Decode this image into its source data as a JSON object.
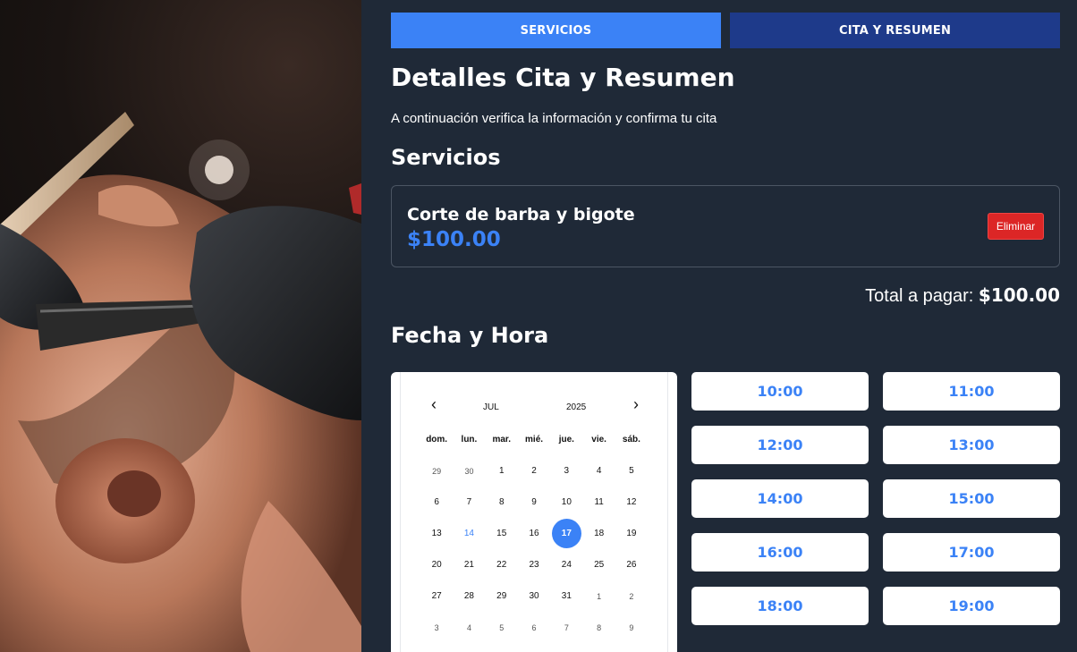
{
  "tabs": [
    {
      "label": "SERVICIOS"
    },
    {
      "label": "CITA Y RESUMEN"
    }
  ],
  "header": {
    "title": "Detalles Cita y Resumen",
    "subtitle": "A continuación verifica la información y confirma tu cita"
  },
  "services_section": {
    "heading": "Servicios",
    "items": [
      {
        "name": "Corte de barba y bigote",
        "price": "$100.00",
        "remove_label": "Eliminar"
      }
    ]
  },
  "total": {
    "label": "Total a pagar:",
    "value": "$100.00"
  },
  "datetime_section": {
    "heading": "Fecha y Hora"
  },
  "calendar": {
    "month": "JUL",
    "year": "2025",
    "prev_icon": "‹",
    "next_icon": "›",
    "weekdays": [
      "dom.",
      "lun.",
      "mar.",
      "mié.",
      "jue.",
      "vie.",
      "sáb."
    ],
    "days": [
      {
        "d": "29",
        "t": "other"
      },
      {
        "d": "30",
        "t": "other"
      },
      {
        "d": "1"
      },
      {
        "d": "2"
      },
      {
        "d": "3"
      },
      {
        "d": "4"
      },
      {
        "d": "5"
      },
      {
        "d": "6"
      },
      {
        "d": "7"
      },
      {
        "d": "8"
      },
      {
        "d": "9"
      },
      {
        "d": "10"
      },
      {
        "d": "11"
      },
      {
        "d": "12"
      },
      {
        "d": "13"
      },
      {
        "d": "14",
        "t": "today"
      },
      {
        "d": "15"
      },
      {
        "d": "16"
      },
      {
        "d": "17",
        "t": "selected"
      },
      {
        "d": "18"
      },
      {
        "d": "19"
      },
      {
        "d": "20"
      },
      {
        "d": "21"
      },
      {
        "d": "22"
      },
      {
        "d": "23"
      },
      {
        "d": "24"
      },
      {
        "d": "25"
      },
      {
        "d": "26"
      },
      {
        "d": "27"
      },
      {
        "d": "28"
      },
      {
        "d": "29"
      },
      {
        "d": "30"
      },
      {
        "d": "31"
      },
      {
        "d": "1",
        "t": "other"
      },
      {
        "d": "2",
        "t": "other"
      },
      {
        "d": "3",
        "t": "other"
      },
      {
        "d": "4",
        "t": "other"
      },
      {
        "d": "5",
        "t": "other"
      },
      {
        "d": "6",
        "t": "other"
      },
      {
        "d": "7",
        "t": "other"
      },
      {
        "d": "8",
        "t": "other"
      },
      {
        "d": "9",
        "t": "other"
      }
    ],
    "selected_day": "17",
    "accent_color": "#3b82f6"
  },
  "times": [
    "10:00",
    "11:00",
    "12:00",
    "13:00",
    "14:00",
    "15:00",
    "16:00",
    "17:00",
    "18:00",
    "19:00"
  ],
  "colors": {
    "background": "#1f2937",
    "tab_services": "#3b82f6",
    "tab_summary": "#1e3a8a",
    "price": "#3b82f6",
    "remove_button": "#dc2626"
  }
}
